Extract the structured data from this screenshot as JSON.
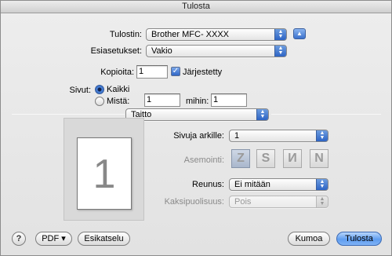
{
  "window": {
    "title": "Tulosta"
  },
  "printer": {
    "label": "Tulostin:",
    "value": "Brother MFC- XXXX"
  },
  "presets": {
    "label": "Esiasetukset:",
    "value": "Vakio"
  },
  "copies": {
    "label": "Kopioita:",
    "value": "1",
    "collated_label": "Järjestetty",
    "collated_checked": true
  },
  "pages": {
    "label": "Sivut:",
    "all_label": "Kaikki",
    "from_label": "Mistä:",
    "from_value": "1",
    "to_label": "mihin:",
    "to_value": "1",
    "selected": "all"
  },
  "section_popup": {
    "value": "Taitto"
  },
  "layout": {
    "pages_per_sheet_label": "Sivuja arkille:",
    "pages_per_sheet_value": "1",
    "direction_label": "Asemointi:",
    "direction_icons": [
      "layout-z-icon",
      "layout-s-icon",
      "layout-n-reverse-icon",
      "layout-n-icon"
    ],
    "direction_glyphs": [
      "Z",
      "S",
      "И",
      "N"
    ],
    "border_label": "Reunus:",
    "border_value": "Ei mitään",
    "twosided_label": "Kaksipuolisuus:",
    "twosided_value": "Pois",
    "preview_page_number": "1"
  },
  "footer": {
    "help_symbol": "?",
    "pdf_label": "PDF ▾",
    "preview_label": "Esikatselu",
    "cancel_label": "Kumoa",
    "print_label": "Tulosta"
  },
  "colors": {
    "accent": "#3b71cc",
    "window_bg": "#e6e6e6"
  }
}
